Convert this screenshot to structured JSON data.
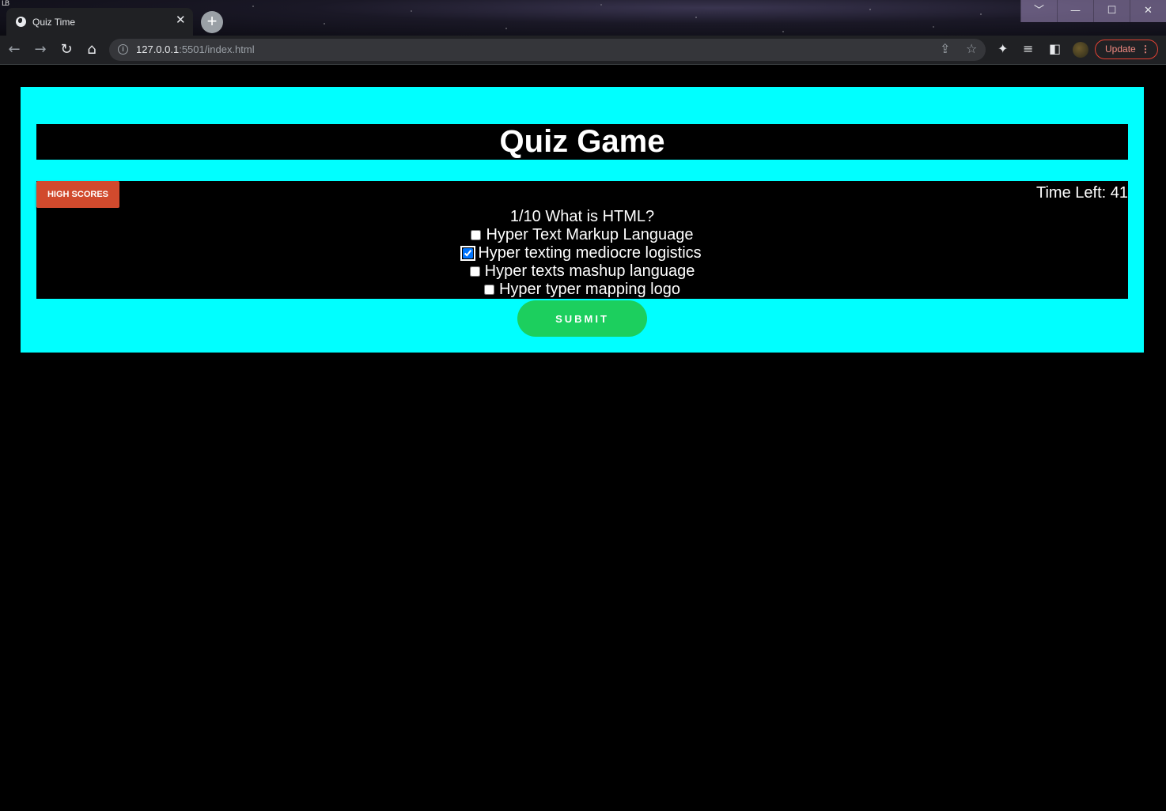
{
  "browser": {
    "corner_glyph": "LB",
    "tab_title": "Quiz Time",
    "tab_close": "✕",
    "new_tab": "+",
    "url_host": "127.0.0.1",
    "url_rest": ":5501/index.html",
    "update_label": "Update",
    "window_buttons": [
      "﹀",
      "—",
      "☐",
      "✕"
    ]
  },
  "page": {
    "title": "Quiz Game",
    "high_scores_label": "HIGH SCORES",
    "timer": "Time Left: 41",
    "question": "1/10 What is HTML?",
    "choices": [
      {
        "label": "Hyper Text Markup Language",
        "checked": false
      },
      {
        "label": "Hyper texting mediocre logistics",
        "checked": true
      },
      {
        "label": "Hyper texts mashup language",
        "checked": false
      },
      {
        "label": "Hyper typer mapping logo",
        "checked": false
      }
    ],
    "submit_label": "SUBMIT"
  },
  "colors": {
    "panel": "#00ffff",
    "high_scores_button": "#d14a2d",
    "submit_button": "#1ccf5e",
    "background": "#000000"
  }
}
